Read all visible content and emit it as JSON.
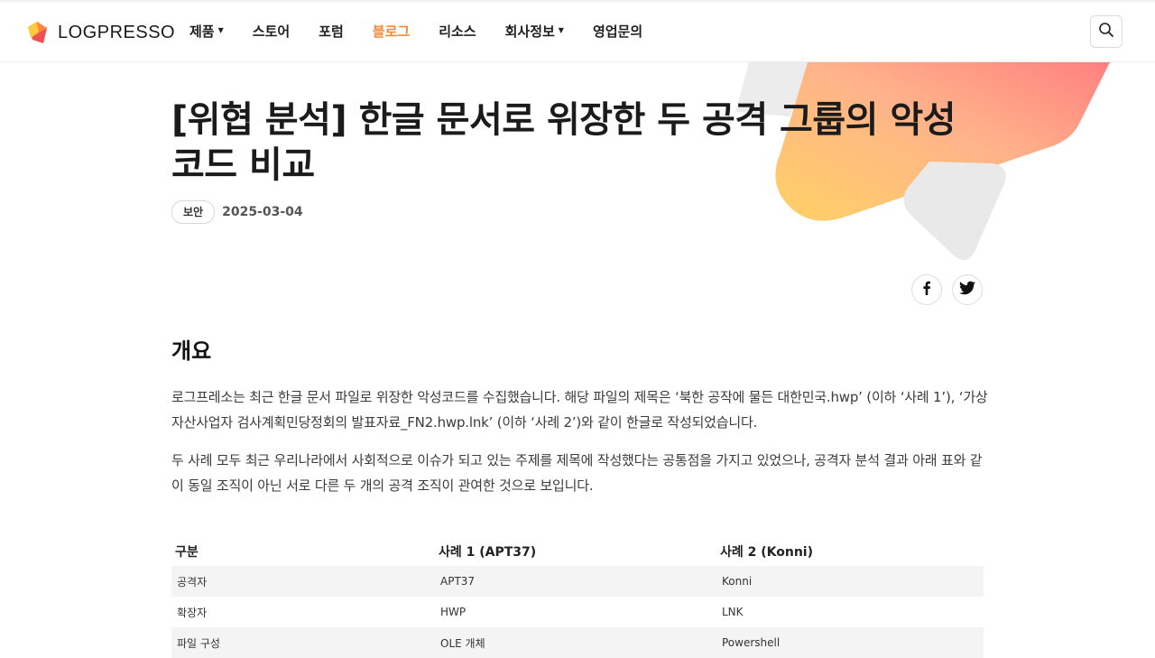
{
  "header": {
    "logo_text": "LOGPRESSO",
    "nav": [
      {
        "label": "제품",
        "has_dropdown": true
      },
      {
        "label": "스토어",
        "has_dropdown": false
      },
      {
        "label": "포럼",
        "has_dropdown": false
      },
      {
        "label": "블로그",
        "has_dropdown": false,
        "active": true
      },
      {
        "label": "리소스",
        "has_dropdown": false
      },
      {
        "label": "회사정보",
        "has_dropdown": true
      },
      {
        "label": "영업문의",
        "has_dropdown": false
      }
    ],
    "search_icon": "search-icon"
  },
  "article": {
    "title": "[위협 분석] 한글 문서로 위장한 두 공격 그룹의 악성코드 비교",
    "tag": "보안",
    "date": "2025-03-04",
    "share": [
      "facebook-icon",
      "twitter-icon"
    ],
    "section_heading": "개요",
    "paragraphs": [
      "로그프레소는 최근 한글 문서 파일로 위장한 악성코드를 수집했습니다. 해당 파일의 제목은 ‘북한 공작에 물든 대한민국.hwp’ (이하 ‘사례 1’), ‘가상자산사업자 검사계획민당정회의 발표자료_FN2.hwp.lnk’ (이하 ‘사례 2’)와 같이 한글로 작성되었습니다.",
      "두 사례 모두 최근 우리나라에서 사회적으로 이슈가 되고 있는 주제를 제목에 작성했다는 공통점을 가지고 있었으나, 공격자 분석 결과 아래 표와 같이 동일 조직이 아닌 서로 다른 두 개의 공격 조직이 관여한 것으로 보입니다."
    ],
    "table": {
      "headers": [
        "구분",
        "사례 1 (APT37)",
        "사례 2 (Konni)"
      ],
      "rows": [
        [
          "공격자",
          "APT37",
          "Konni"
        ],
        [
          "확장자",
          "HWP",
          "LNK"
        ],
        [
          "파일 구성",
          "OLE 개체",
          "Powershell"
        ]
      ]
    }
  },
  "colors": {
    "accent": "#f08a3c",
    "logo_red": "#f0504f",
    "logo_yellow": "#ffc93c",
    "deco_gradient": [
      "#ffd166",
      "#ff8a8a"
    ]
  }
}
